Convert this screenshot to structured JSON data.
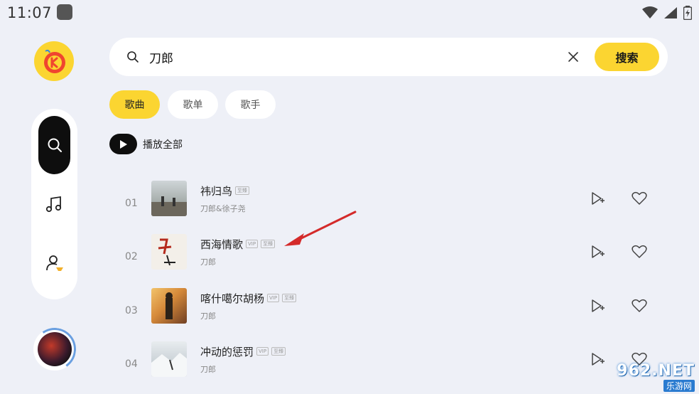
{
  "status_bar": {
    "time": "11:07"
  },
  "search": {
    "query": "刀郎",
    "button_label": "搜索"
  },
  "tabs": [
    {
      "label": "歌曲",
      "active": true
    },
    {
      "label": "歌单",
      "active": false
    },
    {
      "label": "歌手",
      "active": false
    }
  ],
  "play_all": {
    "label": "播放全部"
  },
  "songs": [
    {
      "index": "01",
      "title": "祎归鸟",
      "badges": [
        "至臻"
      ],
      "artist": "刀郎&徐子尧"
    },
    {
      "index": "02",
      "title": "西海情歌",
      "badges": [
        "VIP",
        "至臻"
      ],
      "artist": "刀郎"
    },
    {
      "index": "03",
      "title": "喀什噶尔胡杨",
      "badges": [
        "VIP",
        "至臻"
      ],
      "artist": "刀郎"
    },
    {
      "index": "04",
      "title": "冲动的惩罚",
      "badges": [
        "VIP",
        "至臻"
      ],
      "artist": "刀郎"
    }
  ],
  "watermark": {
    "main": "962.NET",
    "sub": "乐游网"
  },
  "colors": {
    "accent": "#fbd531",
    "background": "#eef0f7",
    "annotation_arrow": "#d42a2a"
  }
}
